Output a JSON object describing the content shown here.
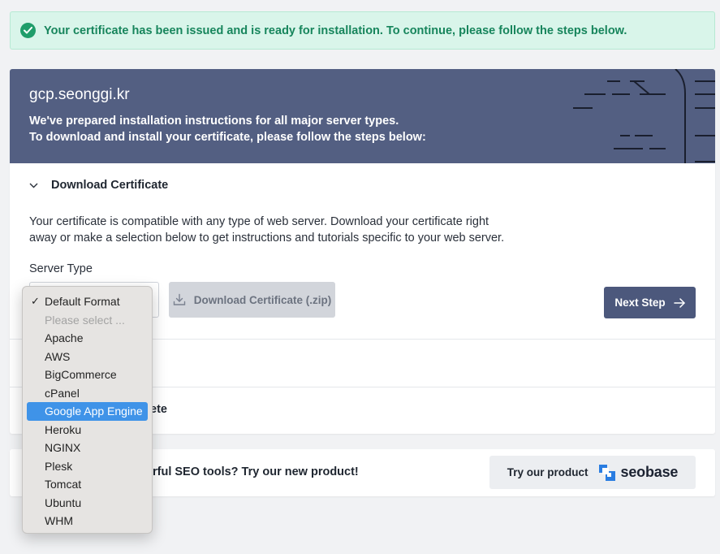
{
  "alert": {
    "message": "Your certificate has been issued and is ready for installation. To continue, please follow the steps below.",
    "icon": "check-circle-icon"
  },
  "hero": {
    "domain": "gcp.seonggi.kr",
    "line1": "We've prepared installation instructions for all major server types.",
    "line2": "To download and install your certificate, please follow the steps below:"
  },
  "download_section": {
    "title": "Download Certificate",
    "description": "Your certificate is compatible with any type of web server. Download your certificate right away or make a selection below to get instructions and tutorials specific to your web server.",
    "server_type_label": "Server Type",
    "download_button": "Download Certificate (.zip)",
    "next_button": "Next Step"
  },
  "steps": {
    "complete_fragment": "ete"
  },
  "promo": {
    "text_fragment": "rful SEO tools? Try our new product!",
    "try_label": "Try our product",
    "brand": "seobase"
  },
  "server_options": [
    {
      "label": "Default Format",
      "checked": "✓"
    },
    {
      "label": "Please select ...",
      "disabled": "true"
    },
    {
      "label": "Apache"
    },
    {
      "label": "AWS"
    },
    {
      "label": "BigCommerce"
    },
    {
      "label": "cPanel"
    },
    {
      "label": "Google App Engine",
      "highlighted": "true"
    },
    {
      "label": "Heroku"
    },
    {
      "label": "NGINX"
    },
    {
      "label": "Plesk"
    },
    {
      "label": "Tomcat"
    },
    {
      "label": "Ubuntu"
    },
    {
      "label": "WHM"
    }
  ],
  "colors": {
    "accent": "#4c587c",
    "hero_bg": "#535f82",
    "success": "#17855c",
    "highlight": "#3f93e8"
  }
}
